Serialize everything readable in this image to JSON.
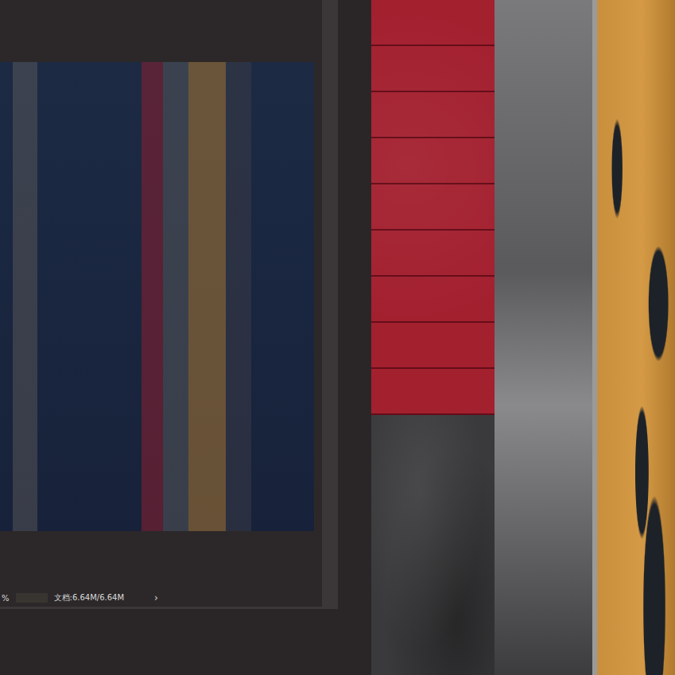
{
  "document_window": {
    "status_bar": {
      "zoom": "%",
      "document_size": "文档:6.64M/6.64M",
      "arrow": "›"
    }
  },
  "canvas": {
    "swatches": [
      {
        "name": "red-texture",
        "color": "#a3202f"
      },
      {
        "name": "dark-texture",
        "color": "#3a3a3c"
      },
      {
        "name": "gray-texture",
        "color": "#6e6e70"
      },
      {
        "name": "gold-texture",
        "color": "#c98f3c"
      }
    ]
  }
}
